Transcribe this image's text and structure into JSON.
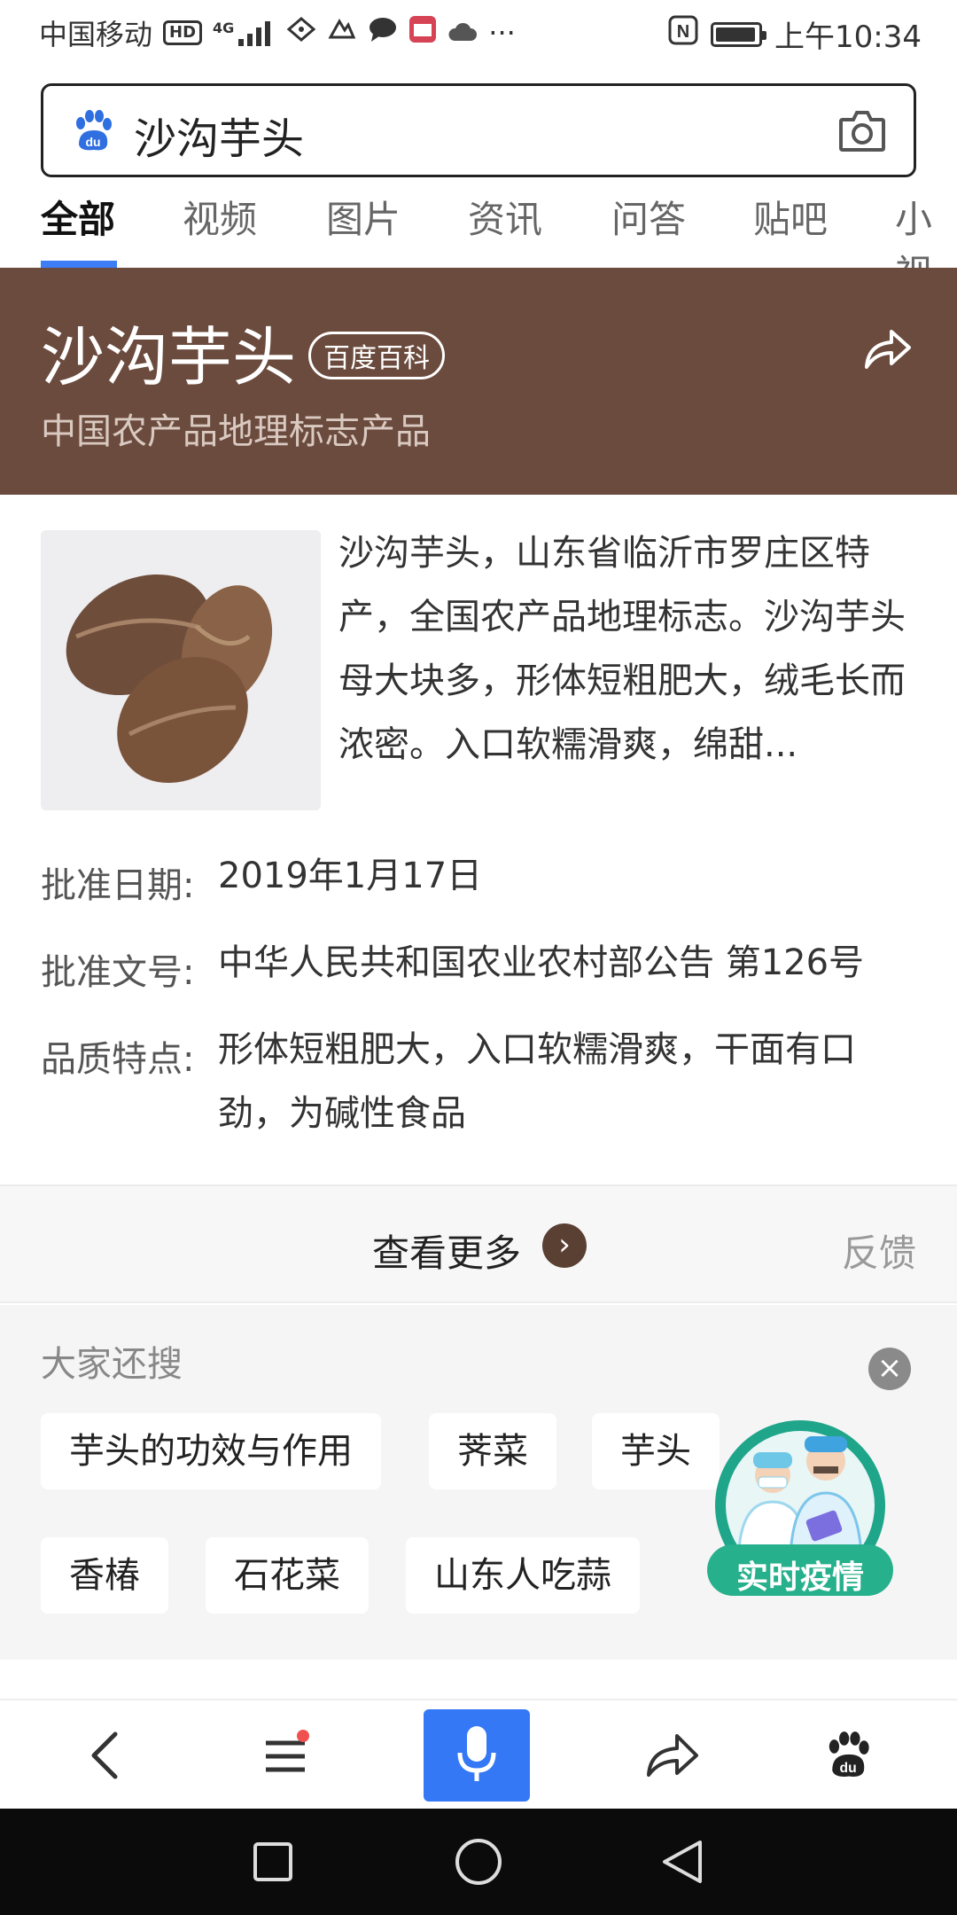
{
  "status_bar": {
    "carrier": "中国移动",
    "hd_badge": "HD",
    "network": "4G",
    "more": "···",
    "nfc": "N",
    "time": "上午10:34",
    "battery_level": 0.95
  },
  "search": {
    "query": "沙沟芋头",
    "logo_icon": "baidu-paw-icon",
    "camera_icon": "camera-icon"
  },
  "tabs": [
    {
      "label": "全部",
      "active": true
    },
    {
      "label": "视频",
      "active": false
    },
    {
      "label": "图片",
      "active": false
    },
    {
      "label": "资讯",
      "active": false
    },
    {
      "label": "问答",
      "active": false
    },
    {
      "label": "贴吧",
      "active": false
    },
    {
      "label": "小视",
      "active": false
    }
  ],
  "hero": {
    "title": "沙沟芋头",
    "badge": "百度百科",
    "subtitle": "中国农产品地理标志产品",
    "background": "#6b4b3e"
  },
  "summary": "沙沟芋头，山东省临沂市罗庄区特产，全国农产品地理标志。沙沟芋头母大块多，形体短粗肥大，绒毛长而浓密。入口软糯滑爽，绵甜...",
  "fields": [
    {
      "label": "批准日期:",
      "value": "2019年1月17日"
    },
    {
      "label": "批准文号:",
      "value": "中华人民共和国农业农村部公告 第126号"
    },
    {
      "label": "品质特点:",
      "value": "形体短粗肥大，入口软糯滑爽，干面有口劲，为碱性食品"
    }
  ],
  "more": {
    "label": "查看更多",
    "arrow": "›",
    "feedback": "反馈"
  },
  "related": {
    "title": "大家还搜",
    "close": "×",
    "items": [
      "芋头的功效与作用",
      "荠菜",
      "芋头",
      "香椿",
      "石花菜",
      "山东人吃蒜"
    ]
  },
  "covid_badge": {
    "label": "实时疫情"
  },
  "toolbar": {
    "back_icon": "back-icon",
    "menu_icon": "menu-icon",
    "mic_icon": "microphone-icon",
    "share_icon": "share-icon",
    "home_icon": "baidu-paw-icon",
    "accent": "#3478f6"
  }
}
